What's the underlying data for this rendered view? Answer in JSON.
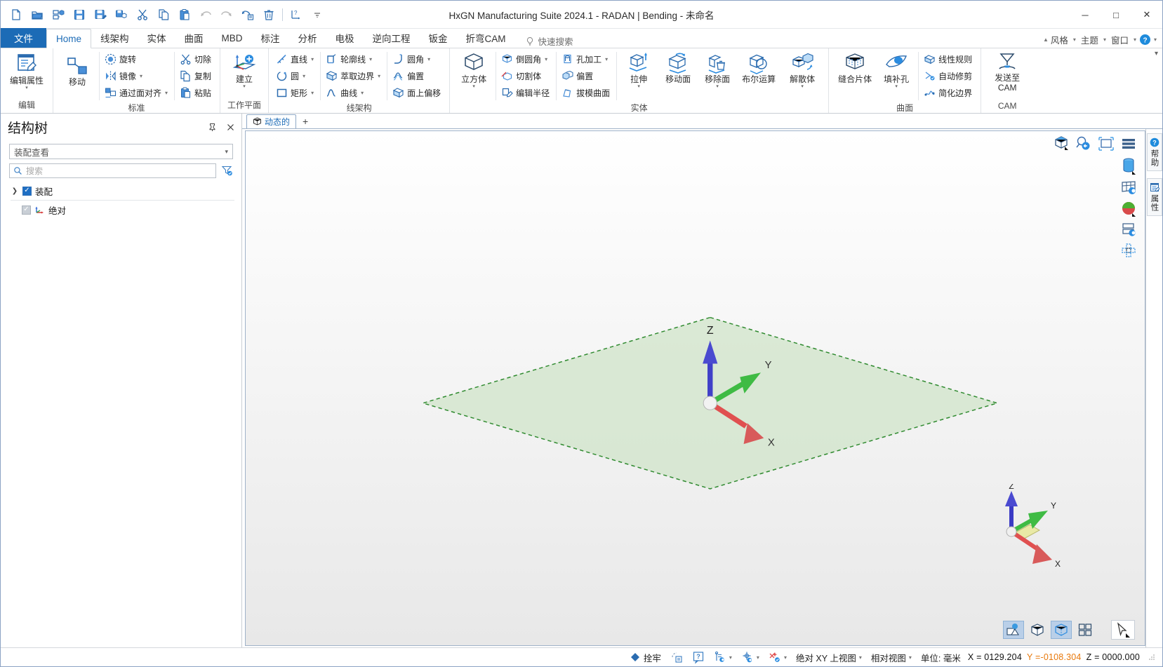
{
  "window": {
    "title": "HxGN Manufacturing Suite 2024.1 - RADAN | Bending - 未命名",
    "minimize": "─",
    "maximize": "□",
    "close": "✕"
  },
  "quick_access": [
    {
      "name": "new-file-icon",
      "title": "新建"
    },
    {
      "name": "open-folder-icon",
      "title": "打开"
    },
    {
      "name": "open-3d-icon",
      "title": "打开3D"
    },
    {
      "name": "save-icon",
      "title": "保存"
    },
    {
      "name": "save-as-icon",
      "title": "另存为"
    },
    {
      "name": "save-3d-icon",
      "title": "保存3D"
    },
    {
      "name": "cut-scissors-icon",
      "title": "剪切"
    },
    {
      "name": "copy-icon",
      "title": "复制"
    },
    {
      "name": "paste-icon",
      "title": "粘贴"
    },
    {
      "name": "undo-icon",
      "title": "撤销"
    },
    {
      "name": "redo-icon",
      "title": "重做"
    },
    {
      "name": "redo-list-icon",
      "title": "重做列表"
    },
    {
      "name": "delete-trash-icon",
      "title": "删除"
    },
    {
      "name": "dimension-icon",
      "title": "标注"
    },
    {
      "name": "qat-overflow-icon",
      "title": "更多"
    }
  ],
  "tabs": [
    {
      "label": "文件",
      "type": "file"
    },
    {
      "label": "Home",
      "type": "active"
    },
    {
      "label": "线架构",
      "type": "normal"
    },
    {
      "label": "实体",
      "type": "normal"
    },
    {
      "label": "曲面",
      "type": "normal"
    },
    {
      "label": "MBD",
      "type": "normal"
    },
    {
      "label": "标注",
      "type": "normal"
    },
    {
      "label": "分析",
      "type": "normal"
    },
    {
      "label": "电极",
      "type": "normal"
    },
    {
      "label": "逆向工程",
      "type": "normal"
    },
    {
      "label": "钣金",
      "type": "normal"
    },
    {
      "label": "折弯CAM",
      "type": "normal"
    }
  ],
  "quick_search": {
    "label": "快速搜索",
    "icon": "lightbulb-icon"
  },
  "tabstrip_right": [
    {
      "label": "风格",
      "icon": "chevron-up-icon"
    },
    {
      "label": "主题",
      "icon": "chevron-down-icon"
    },
    {
      "label": "窗口",
      "icon": "chevron-down-icon"
    },
    {
      "label": "",
      "icon": "help-circle-icon"
    }
  ],
  "ribbon": {
    "groups": [
      {
        "title": "编辑",
        "big": [
          {
            "label": "编辑属性",
            "icon": "edit-properties-icon",
            "dropdown": true
          }
        ]
      },
      {
        "title": "标准",
        "big": [
          {
            "label": "移动",
            "icon": "move-icon",
            "dropdown": false
          }
        ],
        "columns": [
          [
            {
              "label": "旋转",
              "icon": "rotate-icon",
              "dropdown": false
            },
            {
              "label": "镜像",
              "icon": "mirror-icon",
              "dropdown": true
            },
            {
              "label": "通过面对齐",
              "icon": "align-by-face-icon",
              "dropdown": true
            }
          ],
          [
            {
              "label": "切除",
              "icon": "cut-icon",
              "dropdown": false
            },
            {
              "label": "复制",
              "icon": "copy-icon",
              "dropdown": false
            },
            {
              "label": "粘贴",
              "icon": "paste-icon",
              "dropdown": false
            }
          ]
        ]
      },
      {
        "title": "工作平面",
        "big": [
          {
            "label": "建立",
            "icon": "create-workplane-icon",
            "dropdown": true
          }
        ]
      },
      {
        "title": "线架构",
        "columns": [
          [
            {
              "label": "直线",
              "icon": "line-icon",
              "dropdown": true
            },
            {
              "label": "圆",
              "icon": "circle-icon",
              "dropdown": true
            },
            {
              "label": "矩形",
              "icon": "rectangle-icon",
              "dropdown": true
            }
          ],
          [
            {
              "label": "轮廓线",
              "icon": "profile-icon",
              "dropdown": true
            },
            {
              "label": "萃取边界",
              "icon": "extract-boundary-icon",
              "dropdown": true
            },
            {
              "label": "曲线",
              "icon": "spline-icon",
              "dropdown": true
            }
          ],
          [
            {
              "label": "圆角",
              "icon": "fillet-icon",
              "dropdown": true
            },
            {
              "label": "偏置",
              "icon": "offset-icon",
              "dropdown": false
            },
            {
              "label": "面上偏移",
              "icon": "offset-on-face-icon",
              "dropdown": false
            }
          ]
        ]
      },
      {
        "title": "实体",
        "big": [
          {
            "label": "立方体",
            "icon": "cube-icon",
            "dropdown": true
          },
          {
            "label": "拉伸",
            "icon": "extrude-icon",
            "dropdown": true
          },
          {
            "label": "移动面",
            "icon": "move-face-icon",
            "dropdown": false
          },
          {
            "label": "移除面",
            "icon": "remove-face-icon",
            "dropdown": true
          },
          {
            "label": "布尔运算",
            "icon": "boolean-icon",
            "dropdown": false
          },
          {
            "label": "解散体",
            "icon": "explode-body-icon",
            "dropdown": true
          }
        ],
        "columns": [
          [
            {
              "label": "倒圆角",
              "icon": "round-edge-icon",
              "dropdown": true
            },
            {
              "label": "切割体",
              "icon": "split-body-icon",
              "dropdown": false
            },
            {
              "label": "编辑半径",
              "icon": "edit-radius-icon",
              "dropdown": false
            }
          ],
          [
            {
              "label": "孔加工",
              "icon": "hole-machining-icon",
              "dropdown": true
            },
            {
              "label": "偏置",
              "icon": "solid-offset-icon",
              "dropdown": false
            },
            {
              "label": "拔模曲面",
              "icon": "draft-surface-icon",
              "dropdown": false
            }
          ]
        ]
      },
      {
        "title": "曲面",
        "big": [
          {
            "label": "缝合片体",
            "icon": "stitch-sheet-icon",
            "dropdown": false
          },
          {
            "label": "填补孔",
            "icon": "fill-hole-icon",
            "dropdown": true
          }
        ],
        "columns": [
          [
            {
              "label": "线性规则",
              "icon": "ruled-surface-icon",
              "dropdown": false
            },
            {
              "label": "自动修剪",
              "icon": "auto-trim-icon",
              "dropdown": false
            },
            {
              "label": "简化边界",
              "icon": "simplify-boundary-icon",
              "dropdown": false
            }
          ]
        ]
      },
      {
        "title": "CAM",
        "big": [
          {
            "label2": "发送至",
            "label": "CAM",
            "icon": "send-to-cam-icon",
            "dropdown": true
          }
        ]
      }
    ]
  },
  "sidebar": {
    "title": "结构树",
    "pin_icon": "pin-icon",
    "close_icon": "close-icon",
    "view_select": {
      "value": "装配查看",
      "caret": "▾"
    },
    "search": {
      "placeholder": "搜索",
      "icon": "search-icon",
      "filter_icon": "filter-icon"
    },
    "tree": [
      {
        "label": "装配",
        "checked": true,
        "expandable": true,
        "icon": "assembly-icon",
        "indent": 0
      },
      {
        "label": "绝对",
        "checked": true,
        "expandable": false,
        "icon": "axis-triad-icon",
        "indent": 1
      }
    ]
  },
  "document": {
    "tab": {
      "label": "动态的",
      "icon": "model-cube-icon"
    },
    "add_tab": "+"
  },
  "viewport": {
    "top_tools": [
      {
        "name": "view-cube-icon"
      },
      {
        "name": "zoom-previous-icon"
      },
      {
        "name": "fit-to-window-icon"
      },
      {
        "name": "layers-menu-icon"
      }
    ],
    "side_tools": [
      {
        "name": "cylinder-primitive-icon"
      },
      {
        "name": "wireframe-toggle-icon"
      },
      {
        "name": "shaded-sphere-icon"
      },
      {
        "name": "section-view-icon"
      },
      {
        "name": "unfold-view-icon"
      }
    ],
    "bottom_tools": [
      {
        "name": "shaded-render-icon",
        "active": true
      },
      {
        "name": "solid-cube-icon",
        "active": false
      },
      {
        "name": "wireframe-cube-icon",
        "active": true
      },
      {
        "name": "multi-view-icon",
        "active": false
      },
      {
        "name": "select-cursor-icon",
        "active": false
      }
    ],
    "axes": {
      "x": "X",
      "y": "Y",
      "z": "Z"
    },
    "nav_axes": {
      "x": "X",
      "y": "Y",
      "z": "Z"
    },
    "workplane_color": "#cfe3c8"
  },
  "right_dock": [
    {
      "label": "帮助",
      "icon": "help-circle-icon"
    },
    {
      "label": "属性",
      "icon": "properties-icon"
    }
  ],
  "statusbar": {
    "snap": {
      "label": "拴牢",
      "icon": "snap-diamond-icon"
    },
    "tools": [
      {
        "name": "construct-icon"
      },
      {
        "name": "question-box-icon"
      },
      {
        "name": "snap-points-icon",
        "dropdown": true
      },
      {
        "name": "snap-center-icon",
        "dropdown": true
      },
      {
        "name": "snap-intersection-icon",
        "dropdown": true
      }
    ],
    "view_mode": {
      "label": "绝对 XY 上视图",
      "caret": "▾"
    },
    "relative_view": {
      "label": "相对视图",
      "caret": "▾"
    },
    "units": "单位: 毫米",
    "coords": {
      "x": "X = 0129.204",
      "y": "Y =-0108.304",
      "z": "Z = 0000.000"
    },
    "y_color": "#e8780a"
  }
}
